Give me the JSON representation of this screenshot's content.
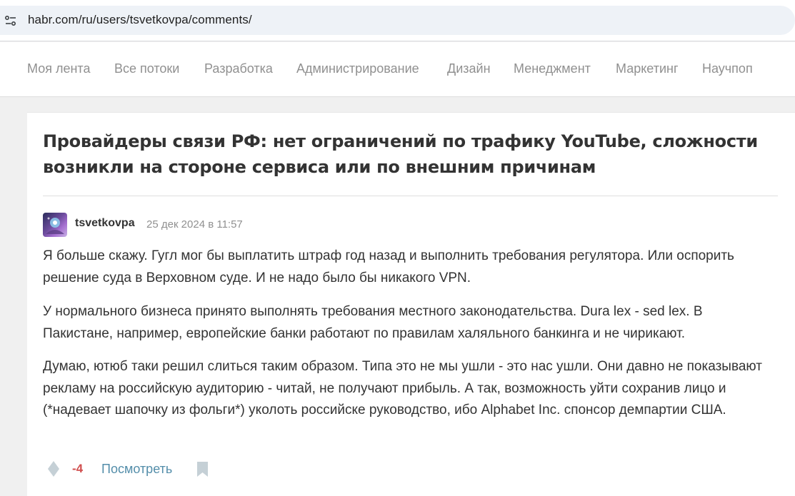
{
  "browser": {
    "url": "habr.com/ru/users/tsvetkovpa/comments/",
    "site_info_icon": "tune-icon"
  },
  "nav": {
    "items": [
      {
        "label": "Моя лента"
      },
      {
        "label": "Все потоки"
      },
      {
        "label": "Разработка"
      },
      {
        "label": "Администрирование"
      },
      {
        "label": "Дизайн"
      },
      {
        "label": "Менеджмент"
      },
      {
        "label": "Маркетинг"
      },
      {
        "label": "Научпоп"
      }
    ]
  },
  "comment": {
    "article_title": "Провайдеры связи РФ: нет ограничений по трафику YouTube, сложности возникли на стороне сервиса или по внешним причинам",
    "author": "tsvetkovpa",
    "timestamp": "25 дек 2024 в 11:57",
    "paragraphs": [
      "Я больше скажу. Гугл мог бы выплатить штраф год назад и выполнить требования регулятора. Или оспорить решение суда в Верховном суде. И не надо было бы никакого VPN.",
      "У нормального бизнеса принято выполнять требования местного законодательства. Dura lex - sed lex. В Пакистане, например, европейские банки работают по правилам халяльного банкинга и не чирикают.",
      "Думаю, ютюб таки решил слиться таким образом. Типа это не мы ушли - это нас ушли. Они давно не показывают рекламу на российскую аудиторию - читай, не получают прибыль. А так, возможность уйти сохранив лицо и (*надевает шапочку из фольги*) уколоть российске руководство, ибо Alphabet Inc. спонсор демпартии США."
    ],
    "score": "-4",
    "view_label": "Посмотреть"
  },
  "colors": {
    "score_negative": "#d04e4e",
    "link": "#548eaa",
    "nav_text": "#909090",
    "icon_gray": "#c5d0d6"
  }
}
